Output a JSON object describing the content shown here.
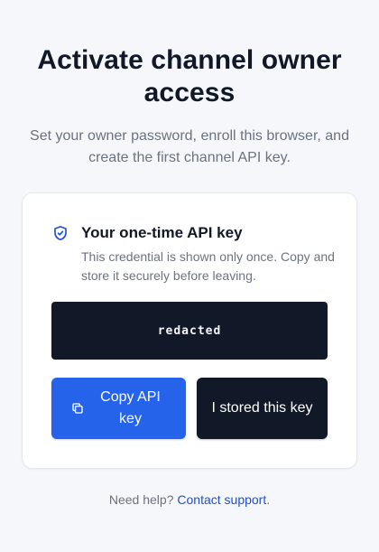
{
  "header": {
    "title": "Activate channel owner access",
    "subtitle": "Set your owner password, enroll this browser, and create the first channel API key."
  },
  "card": {
    "icon": "shield-check-icon",
    "title": "Your one-time API key",
    "description": "This credential is shown only once. Copy and store it securely before leaving.",
    "api_key_value": "redacted",
    "copy_button": {
      "icon": "copy-icon",
      "label": "Copy API key"
    },
    "stored_button": {
      "label": "I stored this key"
    }
  },
  "footer": {
    "help_text": "Need help?",
    "link_text": "Contact support",
    "trailing": "."
  },
  "colors": {
    "background": "#f5f7fa",
    "primary": "#2563eb",
    "dark": "#111827",
    "link": "#1d4ed8",
    "muted": "#6b7280"
  }
}
